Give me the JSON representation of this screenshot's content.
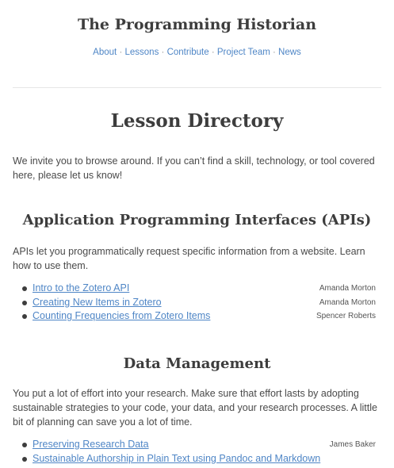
{
  "site": {
    "title": "The Programming Historian"
  },
  "nav": {
    "items": [
      "About",
      "Lessons",
      "Contribute",
      "Project Team",
      "News"
    ],
    "separator": "·"
  },
  "page": {
    "title": "Lesson Directory",
    "intro": "We invite you to browse around. If you can’t find a skill, technology, or tool covered here, please let us know!"
  },
  "sections": [
    {
      "title": "Application Programming Interfaces (APIs)",
      "description": "APIs let you programmatically request specific information from a website. Learn how to use them.",
      "lessons": [
        {
          "title": "Intro to the Zotero API",
          "author": "Amanda Morton"
        },
        {
          "title": "Creating New Items in Zotero",
          "author": "Amanda Morton"
        },
        {
          "title": "Counting Frequencies from Zotero Items",
          "author": "Spencer Roberts"
        }
      ]
    },
    {
      "title": "Data Management",
      "description": "You put a lot of effort into your research. Make sure that effort lasts by adopting sustainable strategies to your code, your data, and your research processes. A little bit of planning can save you a lot of time.",
      "lessons": [
        {
          "title": "Preserving Research Data",
          "author": "James Baker"
        },
        {
          "title": "Sustainable Authorship in Plain Text using Pandoc and Markdown",
          "author": ""
        }
      ]
    }
  ],
  "colors": {
    "link": "#4f86c6",
    "heading": "#3d3d3d",
    "text": "#4a4a4a"
  }
}
